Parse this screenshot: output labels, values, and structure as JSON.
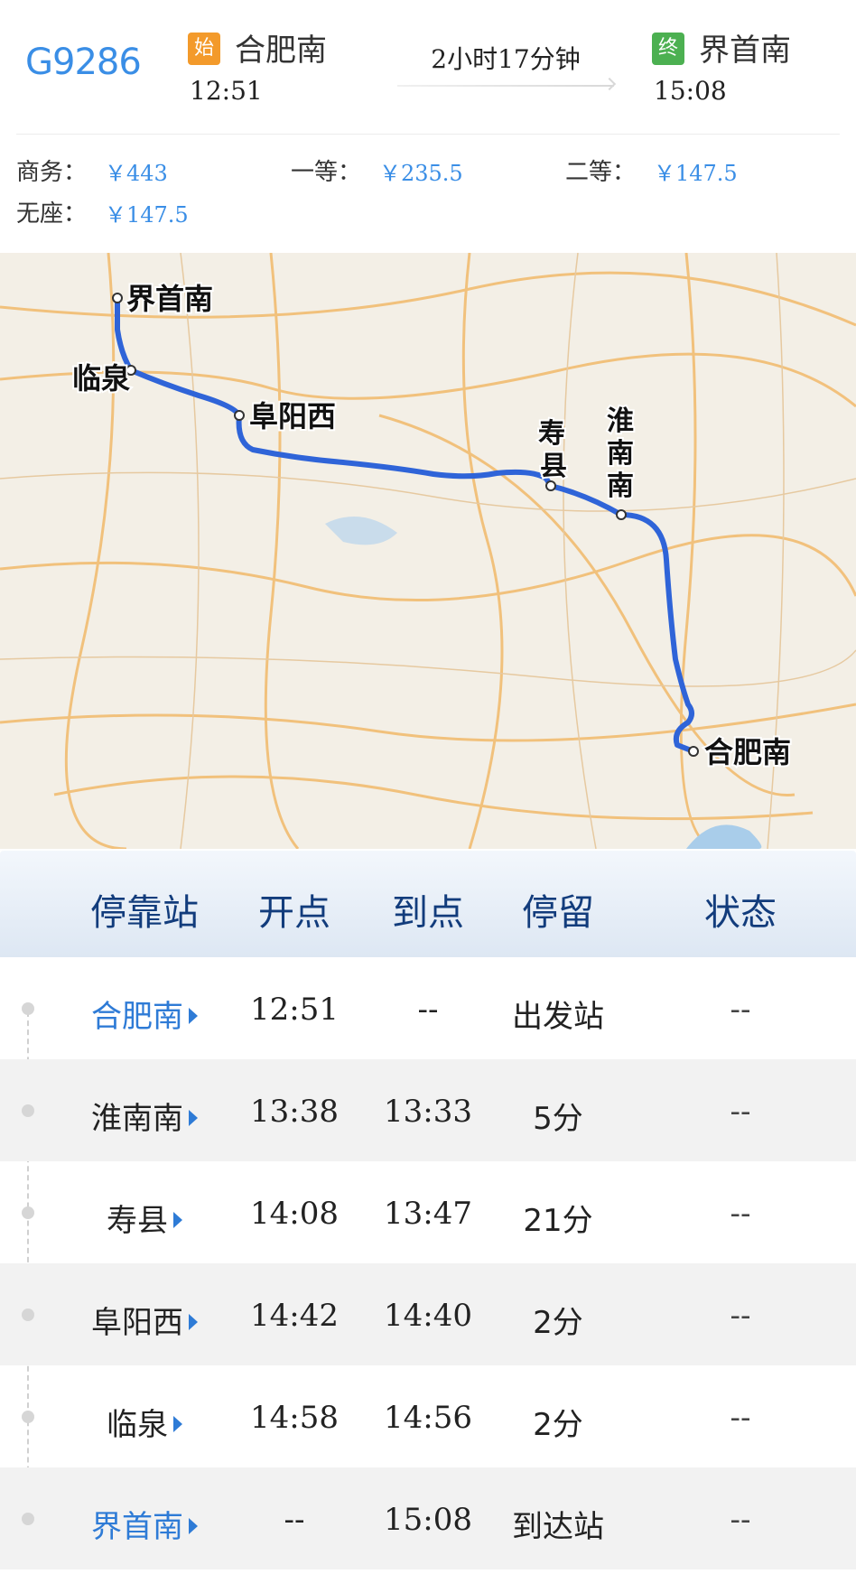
{
  "train": {
    "number": "G9286",
    "start_badge": "始",
    "start_station": "合肥南",
    "start_time": "12:51",
    "duration": "2小时17分钟",
    "end_badge": "终",
    "end_station": "界首南",
    "end_time": "15:08"
  },
  "prices": [
    {
      "label": "商务：",
      "value": "￥443"
    },
    {
      "label": "一等：",
      "value": "￥235.5"
    },
    {
      "label": "二等：",
      "value": "￥147.5"
    },
    {
      "label": "无座：",
      "value": "￥147.5"
    }
  ],
  "map": {
    "stations": [
      "界首南",
      "临泉",
      "阜阳西",
      "寿县",
      "淮南南",
      "合肥南"
    ],
    "route_color": "#2f64d8"
  },
  "table": {
    "headers": {
      "station": "停靠站",
      "departure": "开点",
      "arrival": "到点",
      "stay": "停留",
      "status": "状态"
    },
    "rows": [
      {
        "station": "合肥南",
        "departure": "12:51",
        "arrival": "--",
        "stay": "出发站",
        "status": "--",
        "highlight": true
      },
      {
        "station": "淮南南",
        "departure": "13:38",
        "arrival": "13:33",
        "stay": "5分",
        "status": "--",
        "highlight": false
      },
      {
        "station": "寿县",
        "departure": "14:08",
        "arrival": "13:47",
        "stay": "21分",
        "status": "--",
        "highlight": false
      },
      {
        "station": "阜阳西",
        "departure": "14:42",
        "arrival": "14:40",
        "stay": "2分",
        "status": "--",
        "highlight": false
      },
      {
        "station": "临泉",
        "departure": "14:58",
        "arrival": "14:56",
        "stay": "2分",
        "status": "--",
        "highlight": false
      },
      {
        "station": "界首南",
        "departure": "--",
        "arrival": "15:08",
        "stay": "到达站",
        "status": "--",
        "highlight": true
      }
    ]
  },
  "colors": {
    "accent": "#3a8ee6",
    "start_badge": "#f39a2b",
    "end_badge": "#4cb051",
    "header_text": "#123c7c"
  }
}
